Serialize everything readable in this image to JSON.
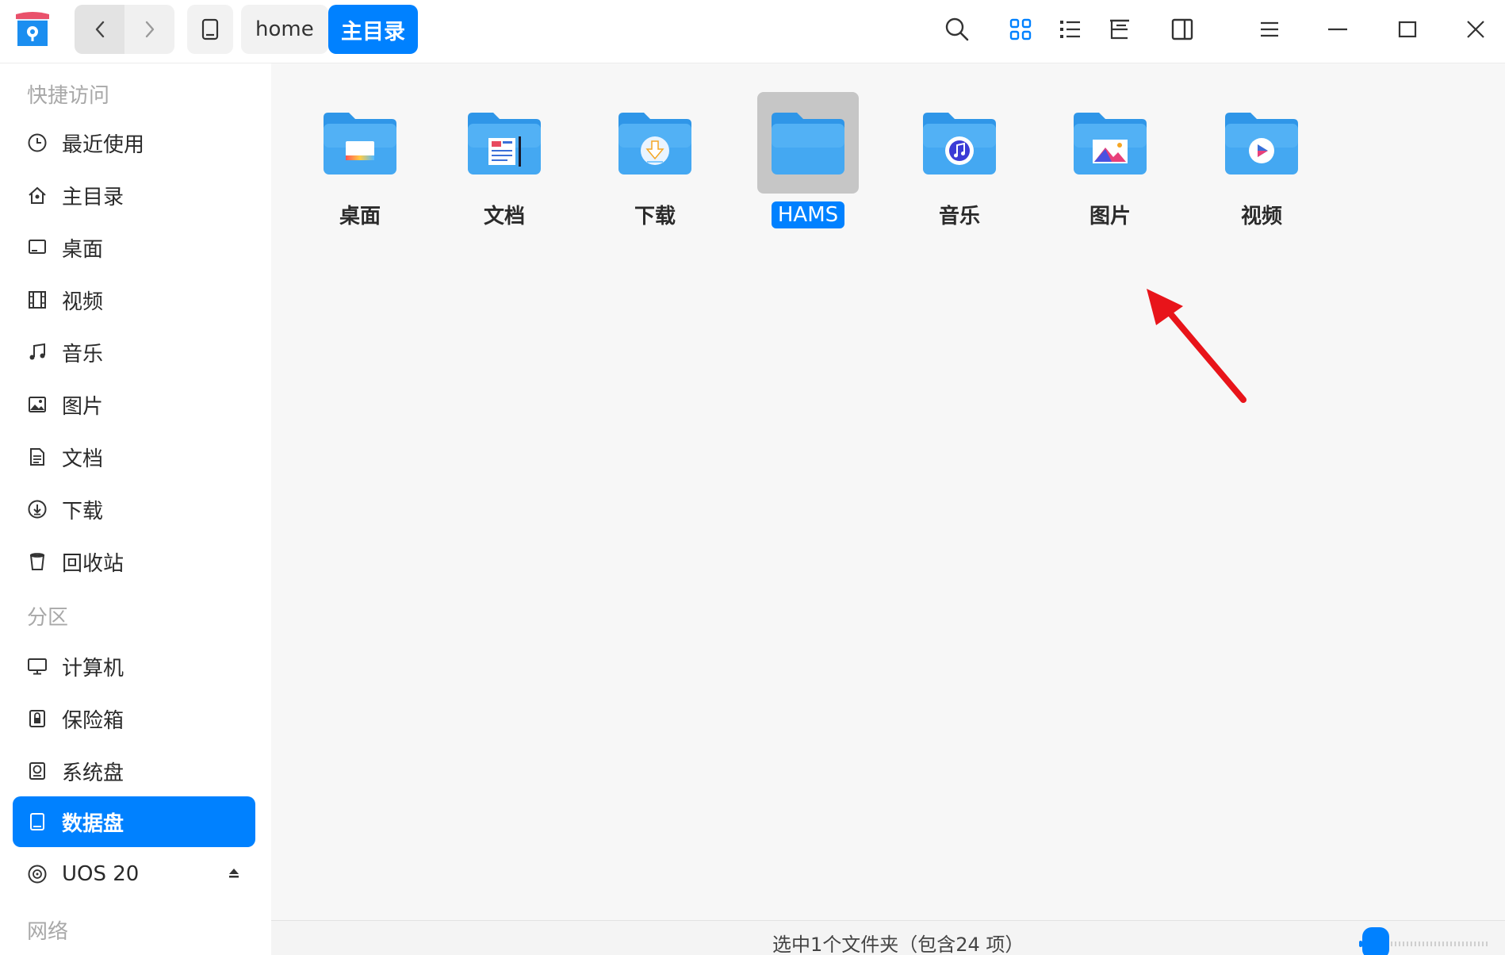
{
  "titlebar": {
    "breadcrumb": [
      {
        "label": "home"
      },
      {
        "label": "主目录"
      }
    ]
  },
  "sidebar": {
    "sections": {
      "quick": "快捷访问",
      "partitions": "分区",
      "network": "网络"
    },
    "quick_items": [
      {
        "label": "最近使用",
        "icon": "clock-icon"
      },
      {
        "label": "主目录",
        "icon": "home-icon"
      },
      {
        "label": "桌面",
        "icon": "desktop-icon"
      },
      {
        "label": "视频",
        "icon": "film-icon"
      },
      {
        "label": "音乐",
        "icon": "music-note-icon"
      },
      {
        "label": "图片",
        "icon": "picture-icon"
      },
      {
        "label": "文档",
        "icon": "document-icon"
      },
      {
        "label": "下载",
        "icon": "download-icon"
      },
      {
        "label": "回收站",
        "icon": "trash-icon"
      }
    ],
    "partition_items": [
      {
        "label": "计算机",
        "icon": "monitor-icon"
      },
      {
        "label": "保险箱",
        "icon": "vault-icon"
      },
      {
        "label": "系统盘",
        "icon": "system-disk-icon"
      },
      {
        "label": "数据盘",
        "icon": "data-disk-icon",
        "active": true
      },
      {
        "label": "UOS 20",
        "icon": "optical-disc-icon"
      }
    ]
  },
  "files": [
    {
      "name": "桌面",
      "emblem": "desktop"
    },
    {
      "name": "文档",
      "emblem": "document"
    },
    {
      "name": "下载",
      "emblem": "download"
    },
    {
      "name": "HAMS",
      "emblem": "none",
      "selected": true
    },
    {
      "name": "音乐",
      "emblem": "music"
    },
    {
      "name": "图片",
      "emblem": "picture"
    },
    {
      "name": "视频",
      "emblem": "video"
    }
  ],
  "statusbar": {
    "text": "选中1个文件夹（包含24 项）",
    "zoom_level": 0.05
  },
  "colors": {
    "accent": "#0081ff",
    "folder_light": "#5ab9f5",
    "folder_dark": "#1f8fe6",
    "annotation_arrow": "#e8141a"
  }
}
